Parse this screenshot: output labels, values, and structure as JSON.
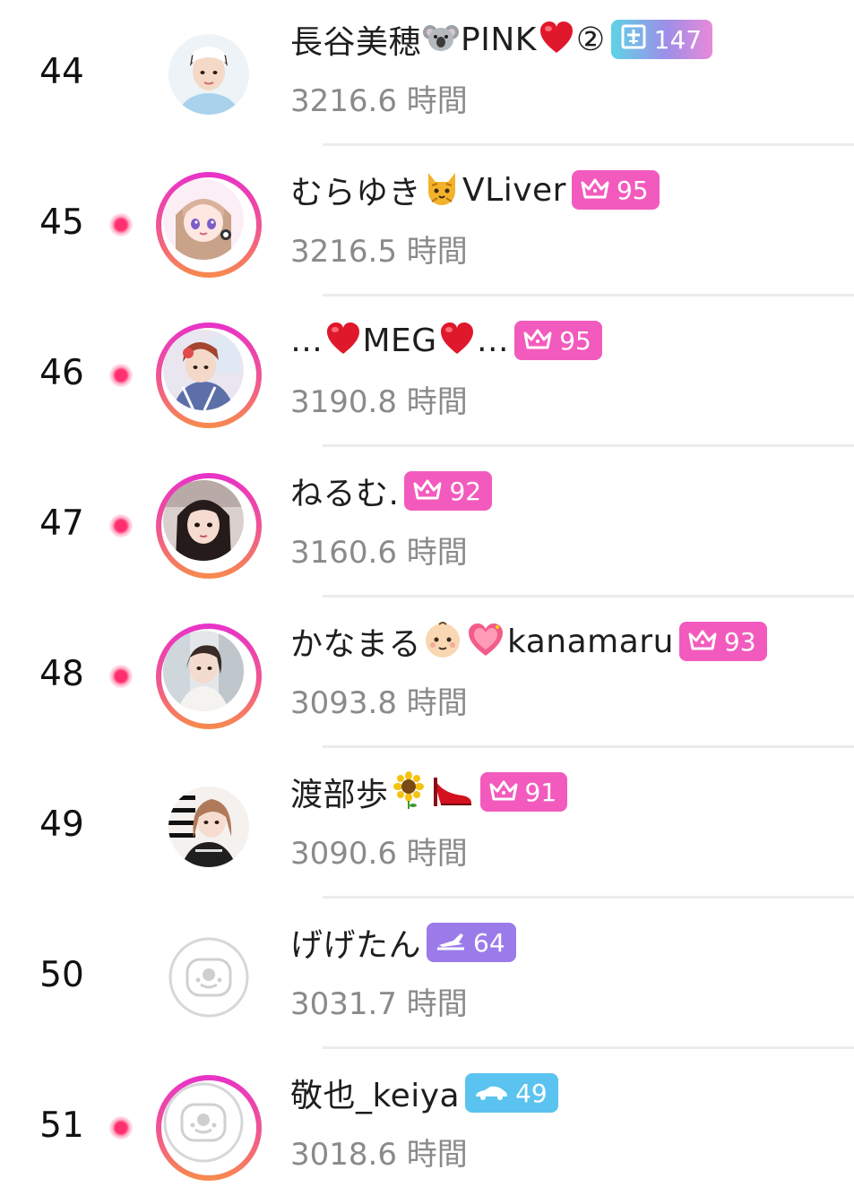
{
  "rows": [
    {
      "rank": "44",
      "live": false,
      "avatar": "photo-avatar",
      "name_parts": [
        "長谷美穂",
        "koala-emoji",
        "PINK",
        "heart-emoji",
        "②"
      ],
      "badge": {
        "type": "gradient",
        "icon": "cross-flag-icon",
        "value": "147"
      },
      "time": "3216.6 時間"
    },
    {
      "rank": "45",
      "live": true,
      "avatar": "anime-avatar",
      "name_parts": [
        "むらゆき",
        "cat-emoji",
        "VLiver"
      ],
      "badge": {
        "type": "pink",
        "icon": "crown-icon",
        "value": "95"
      },
      "time": "3216.5 時間"
    },
    {
      "rank": "46",
      "live": true,
      "avatar": "photo-avatar",
      "name_parts": [
        "…",
        "heart-emoji",
        "MEG",
        "heart-emoji",
        "…"
      ],
      "badge": {
        "type": "pink",
        "icon": "crown-icon",
        "value": "95"
      },
      "time": "3190.8 時間"
    },
    {
      "rank": "47",
      "live": true,
      "avatar": "photo-avatar",
      "name_parts": [
        "ねるむ."
      ],
      "badge": {
        "type": "pink",
        "icon": "crown-icon",
        "value": "92"
      },
      "time": "3160.6 時間"
    },
    {
      "rank": "48",
      "live": true,
      "avatar": "photo-avatar",
      "name_parts": [
        "かなまる",
        "baby-emoji",
        "sparkle-heart-emoji",
        "kanamaru"
      ],
      "badge": {
        "type": "pink",
        "icon": "crown-icon",
        "value": "93"
      },
      "time": "3093.8 時間"
    },
    {
      "rank": "49",
      "live": false,
      "avatar": "photo-avatar",
      "name_parts": [
        "渡部歩",
        "sunflower-emoji",
        "high-heel-emoji"
      ],
      "badge": {
        "type": "pink",
        "icon": "crown-icon",
        "value": "91"
      },
      "time": "3090.6 時間"
    },
    {
      "rank": "50",
      "live": false,
      "avatar": "default-avatar",
      "name_parts": [
        "げげたん"
      ],
      "badge": {
        "type": "purple",
        "icon": "airplane-icon",
        "value": "64"
      },
      "time": "3031.7 時間"
    },
    {
      "rank": "51",
      "live": true,
      "avatar": "default-avatar",
      "name_parts": [
        "敬也_keiya"
      ],
      "badge": {
        "type": "skyblue",
        "icon": "car-icon",
        "value": "49"
      },
      "time": "3018.6 時間"
    }
  ],
  "colors": {
    "live_ring_top": "#e832c9",
    "live_ring_bottom": "#f78b4c",
    "live_dot": "#ff2f6f",
    "badge_pink": "#f25bbd",
    "badge_purple": "#9b7bea",
    "badge_skyblue": "#5bc3ef",
    "time_text": "#8a8a8a",
    "divider": "#ececec"
  }
}
